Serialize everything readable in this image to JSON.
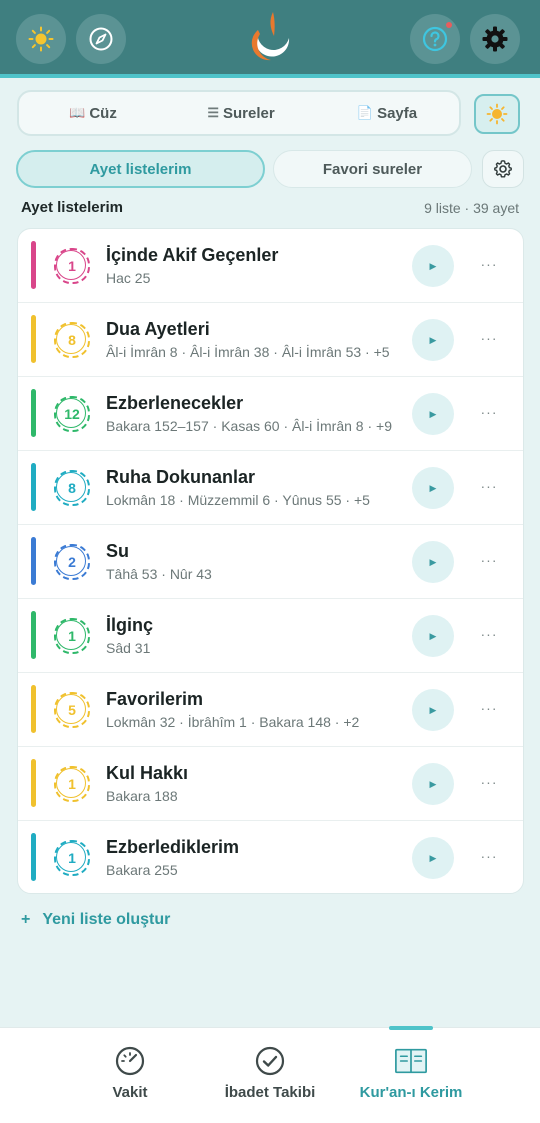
{
  "topbar": {
    "left_buttons": [
      {
        "icon": "sun-icon"
      },
      {
        "icon": "compass-icon"
      }
    ],
    "right_buttons": [
      {
        "icon": "help-icon",
        "has_badge": true
      },
      {
        "icon": "gear-icon"
      }
    ],
    "logo_icon": "crescent-logo"
  },
  "segmented": {
    "items": [
      {
        "icon": "📖",
        "label": "Cüz"
      },
      {
        "icon": "☰",
        "label": "Sureler"
      },
      {
        "icon": "📄",
        "label": "Sayfa"
      }
    ],
    "theme_button_icon": "sun-icon"
  },
  "tabs": {
    "active": "Ayet listelerim",
    "inactive": "Favori sureler",
    "settings_icon": "gear-icon"
  },
  "section": {
    "title": "Ayet listelerim",
    "meta": "9 liste · 39 ayet"
  },
  "lists": [
    {
      "count": "1",
      "title": "İçinde Akif Geçenler",
      "subtitle": "Hac 25",
      "color": "#d9468a"
    },
    {
      "count": "8",
      "title": "Dua Ayetleri",
      "subtitle": "Âl-i İmrân 8 · Âl-i İmrân 38 · Âl-i İmrân 53 · +5",
      "color": "#f0c12e"
    },
    {
      "count": "12",
      "title": "Ezberlenecekler",
      "subtitle": "Bakara 152–157 · Kasas 60 · Âl-i İmrân 8 · +9",
      "color": "#2fb86a"
    },
    {
      "count": "8",
      "title": "Ruha Dokunanlar",
      "subtitle": "Lokmân 18 · Müzzemmil 6 · Yûnus 55 · +5",
      "color": "#20acc2"
    },
    {
      "count": "2",
      "title": "Su",
      "subtitle": "Tâhâ 53 · Nûr 43",
      "color": "#3b7bd4"
    },
    {
      "count": "1",
      "title": "İlginç",
      "subtitle": "Sâd 31",
      "color": "#2fb86a"
    },
    {
      "count": "5",
      "title": "Favorilerim",
      "subtitle": "Lokmân 32 · İbrâhîm 1 · Bakara 148 · +2",
      "color": "#f0c12e"
    },
    {
      "count": "1",
      "title": "Kul Hakkı",
      "subtitle": "Bakara 188",
      "color": "#f0c12e"
    },
    {
      "count": "1",
      "title": "Ezberlediklerim",
      "subtitle": "Bakara 255",
      "color": "#20acc2"
    }
  ],
  "row_actions": {
    "play_glyph": "▶",
    "more_glyph": "···"
  },
  "new_list": {
    "plus": "+",
    "label": "Yeni liste oluştur"
  },
  "bottom_nav": [
    {
      "label": "Vakit",
      "icon": "gauge-icon",
      "active": false
    },
    {
      "label": "İbadet Takibi",
      "icon": "check-circle-icon",
      "active": false
    },
    {
      "label": "Kur'an-ı Kerim",
      "icon": "open-book-icon",
      "active": true
    }
  ]
}
